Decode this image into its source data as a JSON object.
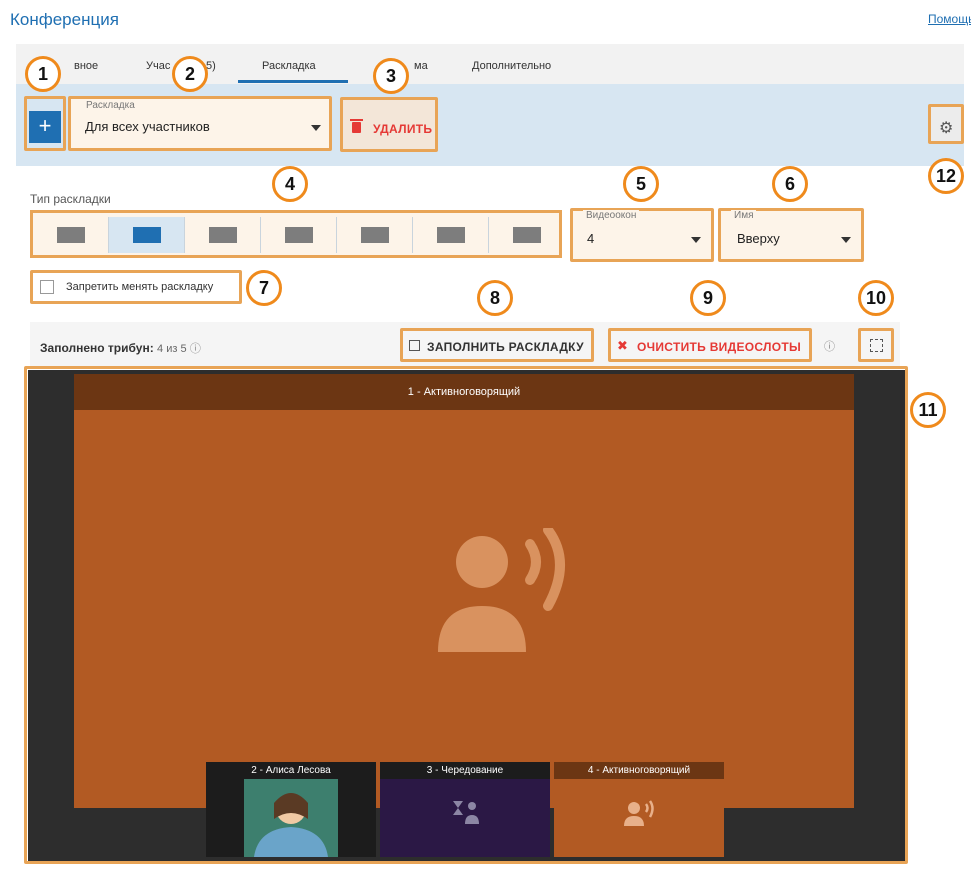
{
  "header": {
    "title": "Конференция",
    "help": "Помощь"
  },
  "tabs": [
    {
      "label": "вное"
    },
    {
      "label": "Учас"
    },
    {
      "label": "5)"
    },
    {
      "label": "Раскладка"
    },
    {
      "label": "ма"
    },
    {
      "label": "Дополнительно"
    }
  ],
  "toolbar": {
    "add_label": "+",
    "layout_select": {
      "legend": "Раскладка",
      "value": "Для всех участников"
    },
    "delete_label": "УДАЛИТЬ"
  },
  "layout_type": {
    "label": "Тип раскладки",
    "active_index": 1
  },
  "video_windows": {
    "legend": "Видеоокон",
    "value": "4"
  },
  "name_position": {
    "legend": "Имя",
    "value": "Вверху"
  },
  "lock_layout": {
    "label": "Запретить менять раскладку",
    "checked": false
  },
  "fill_status": {
    "label": "Заполнено трибун:",
    "value": "4 из 5"
  },
  "fill_button": {
    "label": "ЗАПОЛНИТЬ РАСКЛАДКУ"
  },
  "clear_button": {
    "label": "ОЧИСТИТЬ ВИДЕОСЛОТЫ"
  },
  "slots": {
    "main": "1 - Активноговорящий",
    "thumbs": [
      {
        "label": "2 - Алиса Лесова"
      },
      {
        "label": "3 - Чередование"
      },
      {
        "label": "4 - Активноговорящий"
      }
    ]
  },
  "badges": [
    "1",
    "2",
    "3",
    "4",
    "5",
    "6",
    "7",
    "8",
    "9",
    "10",
    "11",
    "12"
  ],
  "colors": {
    "accent": "#1f6fb2",
    "highlight": "#e8a456",
    "danger": "#e53935",
    "slot": "#b25a23"
  }
}
